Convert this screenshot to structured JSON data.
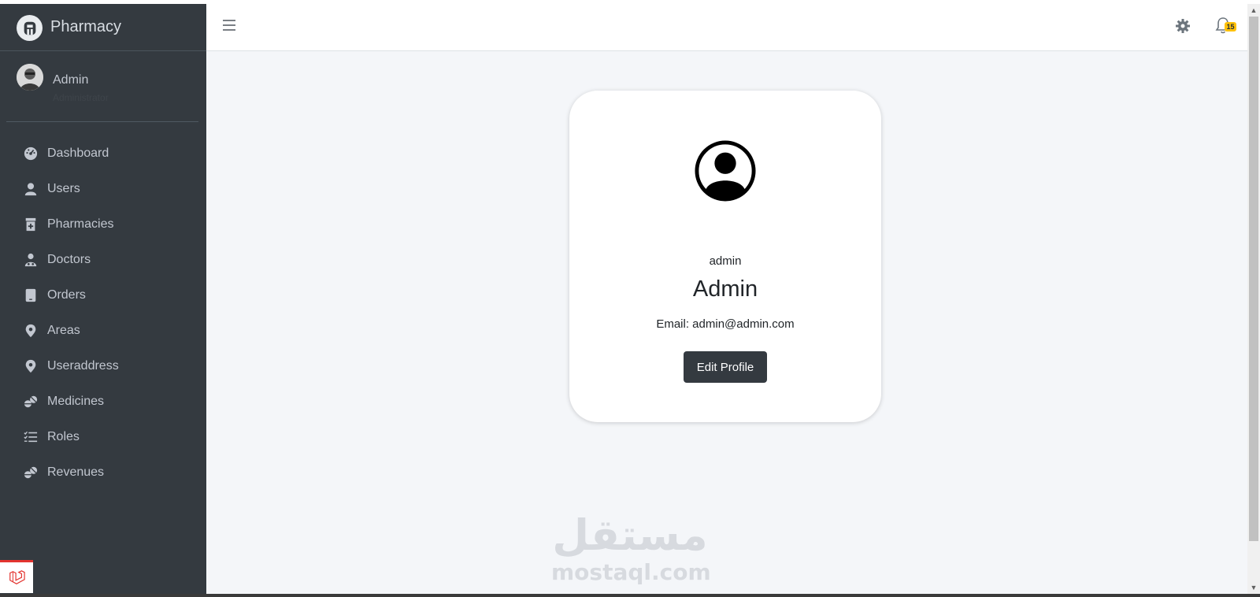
{
  "brand": {
    "name": "Pharmacy",
    "logo_icon": "laravel-a-logo"
  },
  "user_panel": {
    "name": "Admin",
    "role": "Administrator"
  },
  "sidebar": {
    "items": [
      {
        "label": "Dashboard",
        "icon": "tachometer-icon"
      },
      {
        "label": "Users",
        "icon": "user-icon"
      },
      {
        "label": "Pharmacies",
        "icon": "prescription-bottle-icon"
      },
      {
        "label": "Doctors",
        "icon": "user-doctor-icon"
      },
      {
        "label": "Orders",
        "icon": "tablet-icon"
      },
      {
        "label": "Areas",
        "icon": "map-marker-icon"
      },
      {
        "label": "Useraddress",
        "icon": "map-marker-icon"
      },
      {
        "label": "Medicines",
        "icon": "pills-icon"
      },
      {
        "label": "Roles",
        "icon": "list-check-icon"
      },
      {
        "label": "Revenues",
        "icon": "pills-icon"
      }
    ]
  },
  "topbar": {
    "notifications_count": "15"
  },
  "profile": {
    "username": "admin",
    "name": "Admin",
    "email": "Email: admin@admin.com",
    "edit_label": "Edit Profile"
  },
  "watermark": {
    "arabic": "مستقل",
    "latin": "mostaql.com"
  },
  "colors": {
    "sidebar_bg": "#343a40",
    "content_bg": "#f4f6f9",
    "badge": "#ffc107",
    "button": "#343a40"
  }
}
